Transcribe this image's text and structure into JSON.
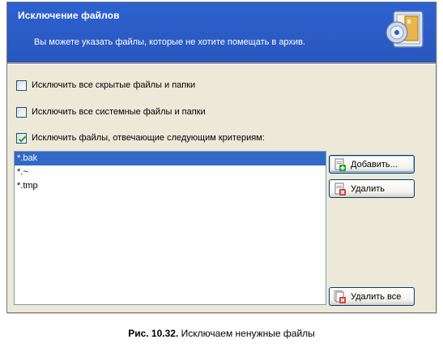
{
  "dialog": {
    "title": "Исключение файлов",
    "subtitle": "Вы можете указать файлы, которые не хотите помещать в архив."
  },
  "options": [
    {
      "label": "Исключить все скрытые файлы и папки",
      "checked": false
    },
    {
      "label": "Исключить все системные файлы и папки",
      "checked": false
    },
    {
      "label": "Исключить файлы, отвечающие следующим критериям:",
      "checked": true
    }
  ],
  "exclusion_list": {
    "items": [
      "*.bak",
      "*.~",
      "*.tmp"
    ],
    "selected_index": 0
  },
  "buttons": {
    "add": "Добавить...",
    "remove": "Удалить",
    "remove_all": "Удалить все"
  },
  "caption": {
    "number": "Рис. 10.32.",
    "text": "Исключаем ненужные файлы"
  },
  "colors": {
    "header": "#2b5bc5",
    "selection": "#316ac5",
    "dialog_bg": "#ece9d8"
  }
}
